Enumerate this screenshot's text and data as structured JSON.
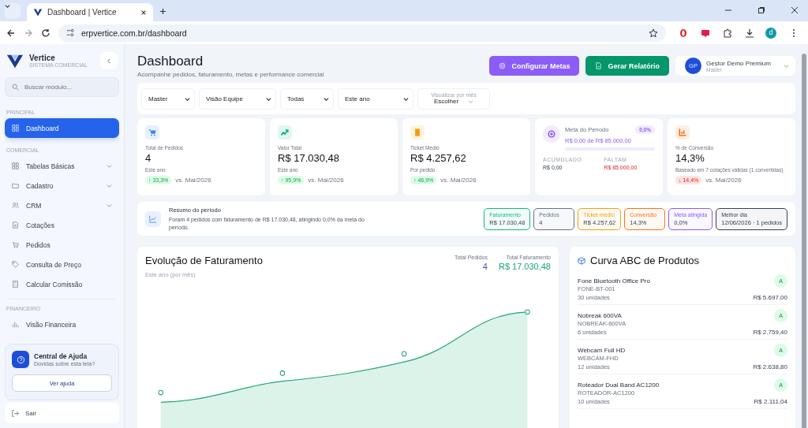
{
  "browser": {
    "tab_title": "Dashboard | Vertice",
    "url": "erpvertice.com.br/dashboard",
    "profile_initial": "d"
  },
  "sidebar": {
    "brand": "Vertice",
    "tagline": "SISTEMA COMERCIAL",
    "search": {
      "placeholder": "Buscar módulo..."
    },
    "sections": [
      {
        "label": "PRINCIPAL",
        "items": [
          {
            "label": "Dashboard",
            "selected": true,
            "expandable": false
          }
        ]
      },
      {
        "label": "COMERCIAL",
        "items": [
          {
            "label": "Tabelas Básicas",
            "selected": false,
            "expandable": true
          },
          {
            "label": "Cadastro",
            "selected": false,
            "expandable": true
          },
          {
            "label": "CRM",
            "selected": false,
            "expandable": true
          },
          {
            "label": "Cotações",
            "selected": false,
            "expandable": false
          },
          {
            "label": "Pedidos",
            "selected": false,
            "expandable": false
          },
          {
            "label": "Consulta de Preço",
            "selected": false,
            "expandable": false
          },
          {
            "label": "Calcular Comissão",
            "selected": false,
            "expandable": false
          }
        ]
      },
      {
        "label": "FINANCEIRO",
        "items": [
          {
            "label": "Visão Financeira",
            "selected": false,
            "expandable": false
          }
        ]
      }
    ],
    "help": {
      "title": "Central de Ajuda",
      "subtitle": "Dúvidas sobre esta tela?",
      "button": "Ver ajuda"
    },
    "logout": "Sair"
  },
  "header": {
    "title": "Dashboard",
    "subtitle": "Acompanhe pedidos, faturamento, metas e performance comercial",
    "buttons": [
      {
        "label": "Configurar Metas",
        "color": "#8b5cf6"
      },
      {
        "label": "Gerar Relatório",
        "color": "#059669"
      }
    ],
    "user": {
      "initials": "GP",
      "name": "Gestor Demo Premium",
      "role": "Master"
    }
  },
  "filters": {
    "selects": [
      "Master",
      "Visão Equipe",
      "Todas",
      "Este ano"
    ],
    "month": {
      "label": "Visualizar por mês",
      "value": "Escolher"
    }
  },
  "kpis": [
    {
      "kind": "stat",
      "color": "#3b82f6",
      "label": "Total de Pedidos",
      "value": "4",
      "caption": "Este ano",
      "change": "↑ 33,3%",
      "positive": true,
      "compare": "vs. Mai/2026"
    },
    {
      "kind": "stat",
      "color": "#10b981",
      "label": "Valor Total",
      "value": "R$ 17.030,48",
      "caption": "Este ano",
      "change": "↑ 95,9%",
      "positive": true,
      "compare": "vs. Mai/2026"
    },
    {
      "kind": "stat",
      "color": "#f59e0b",
      "label": "Ticket Médio",
      "value": "R$ 4.257,62",
      "caption": "Por pedido",
      "change": "↑ 46,9%",
      "positive": true,
      "compare": "vs. Mai/2026"
    },
    {
      "kind": "goal",
      "color": "#8b5cf6",
      "label": "Meta do Período",
      "badge": "0,0%",
      "progress": "R$ 0,00 de R$ 85.000,00",
      "done_label": "ACUMULADO",
      "done_value": "R$ 0,00",
      "left_label": "FALTAM",
      "left_value": "R$ 85.000,00"
    },
    {
      "kind": "stat",
      "color": "#f97316",
      "label": "% de Conversão",
      "value": "14,3%",
      "caption": "Baseado em 7 cotações válidas (1 convertidas)",
      "change": "↓ 14,4%",
      "positive": false,
      "compare": "vs. Mai/2026"
    }
  ],
  "summary": {
    "title": "Resumo do período",
    "text": "Foram 4 pedidos com faturamento de R$ 17.030,48, atingindo 0,0% da meta do período.",
    "chips": [
      {
        "label": "Faturamento",
        "value": "R$ 17.030,48",
        "color": "#10b981"
      },
      {
        "label": "Pedidos",
        "value": "4",
        "color": "#64748b"
      },
      {
        "label": "Ticket médio",
        "value": "R$ 4.257,62",
        "color": "#f59e0b"
      },
      {
        "label": "Conversão",
        "value": "14,3%",
        "color": "#f97316"
      },
      {
        "label": "Meta atingida",
        "value": "0,0%",
        "color": "#8b5cf6"
      },
      {
        "label": "Melhor dia",
        "value": "12/06/2026 · 1 pedidos",
        "color": "#334155"
      }
    ]
  },
  "revenue": {
    "title": "Evolução de Faturamento",
    "subtitle": "Este ano (por mês)",
    "totals": [
      {
        "label": "Total Pedidos",
        "value": "4",
        "color": "#3b5bb5"
      },
      {
        "label": "Total Faturamento",
        "value": "R$ 17.030,48",
        "color": "#16a37a"
      }
    ]
  },
  "abc": {
    "title": "Curva ABC de Produtos",
    "products": [
      {
        "name": "Fone Bluetooth Office Pro",
        "code": "FONE-BT-001",
        "qty": "30 unidades",
        "value": "R$ 5.697,00",
        "class": "A"
      },
      {
        "name": "Nobreak 600VA",
        "code": "NOBREAK-600VA",
        "qty": "6 unidades",
        "value": "R$ 2.759,40",
        "class": "A"
      },
      {
        "name": "Webcam Full HD",
        "code": "WEBCAM-FHD",
        "qty": "12 unidades",
        "value": "R$ 2.638,80",
        "class": "A"
      },
      {
        "name": "Roteador Dual Band AC1200",
        "code": "ROTEADOR-AC1200",
        "qty": "10 unidades",
        "value": "R$ 2.111,04",
        "class": "A"
      }
    ]
  }
}
